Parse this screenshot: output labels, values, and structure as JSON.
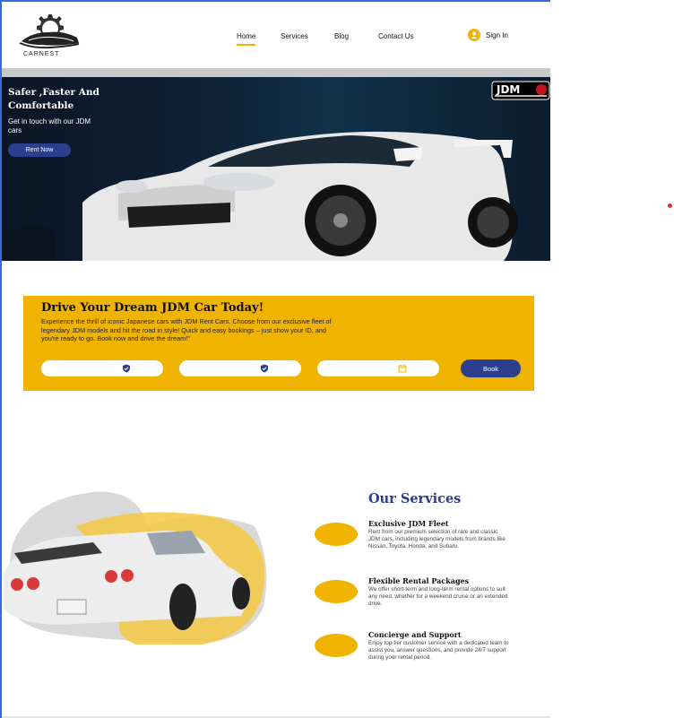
{
  "brand": {
    "name": "CARNEST"
  },
  "nav": {
    "items": [
      {
        "label": "Home",
        "active": true
      },
      {
        "label": "Services",
        "active": false
      },
      {
        "label": "Blog",
        "active": false
      },
      {
        "label": "Contact Us",
        "active": false
      }
    ],
    "signin_label": "Sign In"
  },
  "hero": {
    "title": "Safer ,Faster And Comfortable",
    "subtitle": "Get in touch with our JDM cars",
    "cta": "Rent Now",
    "badge": "JDM"
  },
  "booking": {
    "title": "Drive Your Dream JDM Car Today!",
    "description": "Experience the thrill of iconic Japanese cars with JDM Rent Cars. Choose from our exclusive fleet of legendary JDM models and hit the road in style! Quick and easy bookings – just show your ID, and you're ready to go. Book now and drive the dream!\"",
    "fields": [
      {
        "icon": "shield-check-icon",
        "value": ""
      },
      {
        "icon": "shield-check-icon",
        "value": ""
      },
      {
        "icon": "calendar-icon",
        "value": ""
      }
    ],
    "button": "Book"
  },
  "services": {
    "title": "Our Services",
    "items": [
      {
        "title": "Exclusive JDM Fleet",
        "desc": "Rent from our premium selection of rare and classic JDM cars, including legendary models from brands like Nissan, Toyota, Honda, and Subaru."
      },
      {
        "title": "Flexible Rental Packages",
        "desc": "We offer short-term and long-term rental options to suit any need, whether for a weekend cruise or an extended drive."
      },
      {
        "title": "Concierge and Support",
        "desc": "Enjoy top-tier customer service with a dedicated team to assist you, answer questions, and provide 24/7 support during your rental period."
      }
    ]
  },
  "colors": {
    "accent": "#f0b400",
    "primary": "#2c3f8e",
    "hero_bg": "#0e2236"
  }
}
